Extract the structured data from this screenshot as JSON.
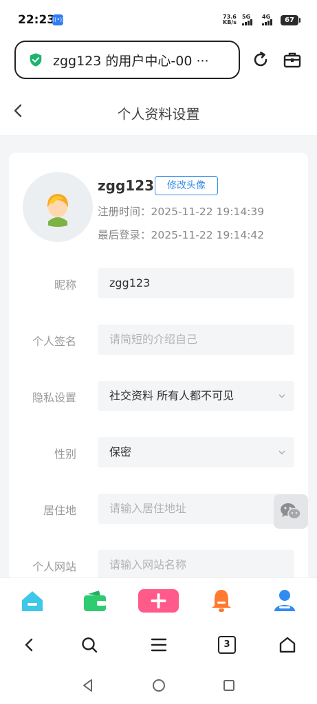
{
  "status_bar": {
    "time": "22:23",
    "net_speed_value": "73.6",
    "net_speed_unit": "KB/s",
    "sim1": "5G",
    "sim2": "4G",
    "battery": "67"
  },
  "browser": {
    "url_title": "zgg123 的用户中心-00 ···",
    "secure_icon": "shield-check-icon",
    "reload_icon": "reload-icon",
    "toolbox_icon": "toolbox-icon"
  },
  "header": {
    "title": "个人资料设置",
    "back_icon": "back-arrow-icon"
  },
  "profile": {
    "username": "zgg123",
    "edit_avatar_label": "修改头像",
    "register_label": "注册时间：",
    "register_time": "2025-11-22 19:14:39",
    "last_login_label": "最后登录：",
    "last_login_time": "2025-11-22 19:14:42"
  },
  "form": {
    "nickname": {
      "label": "昵称",
      "value": "zgg123"
    },
    "signature": {
      "label": "个人签名",
      "placeholder": "请简短的介绍自己"
    },
    "privacy": {
      "label": "隐私设置",
      "value": "社交资料 所有人都不可见"
    },
    "gender": {
      "label": "性别",
      "value": "保密"
    },
    "residence": {
      "label": "居住地",
      "placeholder": "请输入居住地址"
    },
    "website": {
      "label": "个人网站",
      "placeholder": "请输入网站名称"
    }
  },
  "tabs": [
    {
      "icon": "home-icon",
      "color": "#3ec7e8"
    },
    {
      "icon": "wallet-icon",
      "color": "#2ecc71"
    },
    {
      "icon": "add-icon",
      "color": "#ff5a8a"
    },
    {
      "icon": "bell-icon",
      "color": "#ff7a2e"
    },
    {
      "icon": "user-icon",
      "color": "#2f8cf0"
    }
  ],
  "browser_nav": {
    "tab_count": "3"
  },
  "colors": {
    "accent": "#3a8ee6",
    "secure_green": "#1db36c",
    "page_bg": "#f4f5f7"
  }
}
